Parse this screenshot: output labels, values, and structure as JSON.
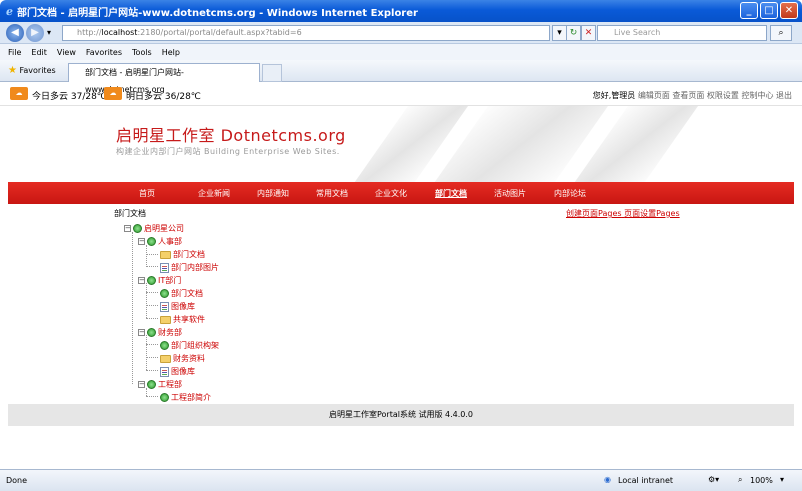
{
  "window": {
    "title": "部门文档 - 启明星门户网站-www.dotnetcms.org - Windows Internet Explorer",
    "minimize": "_",
    "maximize": "□",
    "close": "✕"
  },
  "address": {
    "url_prefix": "http://",
    "url_host": "localhost",
    "url_rest": ":2180/portal/portal/default.aspx?tabid=6",
    "search_placeholder": "Live Search"
  },
  "menu": [
    "File",
    "Edit",
    "View",
    "Favorites",
    "Tools",
    "Help"
  ],
  "favorites": {
    "label": "Favorites",
    "tab_title": "部门文档 - 启明星门户网站-www.dotnetcms.org"
  },
  "weather": {
    "today": "今日多云 37/28℃",
    "tomorrow": "明日多云 36/28℃",
    "greeting": "您好,管理员",
    "links": "编辑页面 查看页面 权限设置 控制中心 退出"
  },
  "banner": {
    "title": "启明星工作室 Dotnetcms.org",
    "subtitle": "构建企业内部门户网站 Building Enterprise Web Sites."
  },
  "nav": [
    "首页",
    "企业新闻",
    "内部通知",
    "常用文档",
    "企业文化",
    "部门文档",
    "活动图片",
    "内部论坛"
  ],
  "content": {
    "breadcrumb": "部门文档",
    "create_link": "创建页面Pages",
    "settings_link": "页面设置Pages"
  },
  "tree": {
    "root": "启明星公司",
    "hr": "人事部",
    "hr_docs": "部门文档",
    "hr_pics": "部门内部图片",
    "it": "IT部门",
    "it_docs": "部门文档",
    "it_images": "图像库",
    "it_share": "共享软件",
    "fin": "财务部",
    "fin_org": "部门组织构架",
    "fin_data": "财务资料",
    "fin_images": "图像库",
    "eng": "工程部",
    "eng_intro": "工程部简介"
  },
  "footer": "启明星工作室Portal系统 试用版 4.4.0.0",
  "status": {
    "left": "Done",
    "zone": "Local intranet",
    "zoom": "100%"
  }
}
